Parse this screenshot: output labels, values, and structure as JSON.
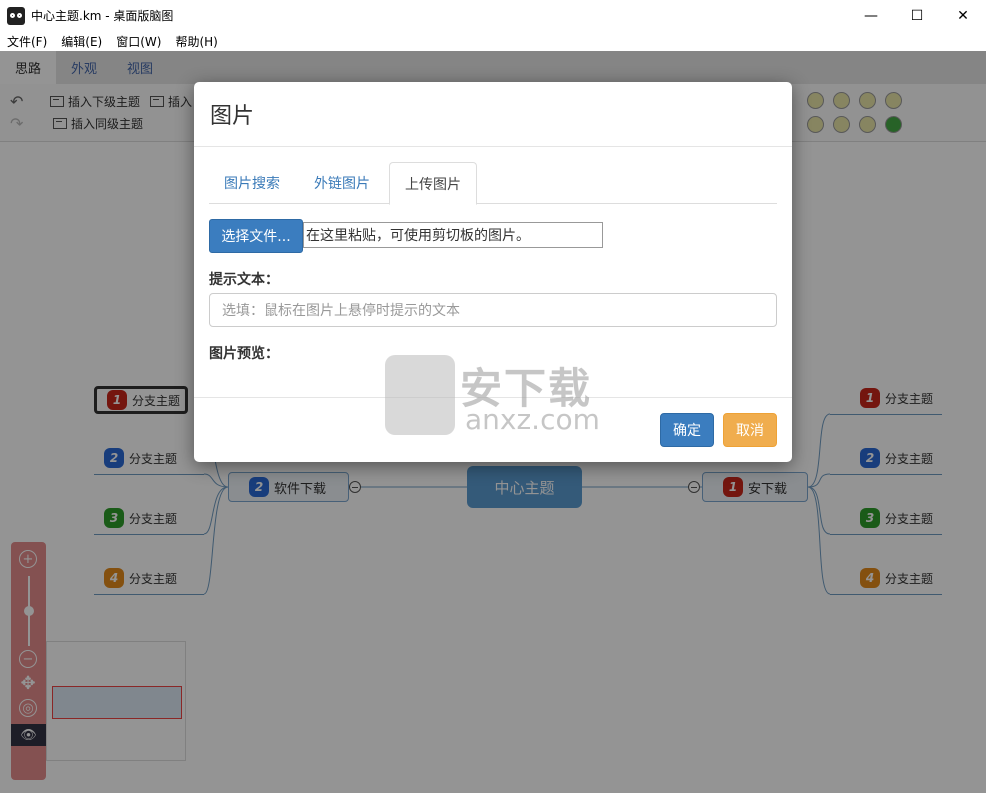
{
  "window": {
    "title": "中心主题.km - 桌面版脑图",
    "minimize": "—",
    "maximize": "☐",
    "close": "✕"
  },
  "menu": [
    "文件(F)",
    "编辑(E)",
    "窗口(W)",
    "帮助(H)"
  ],
  "tabs": [
    "思路",
    "外观",
    "视图"
  ],
  "toolbar": {
    "undo": "↶",
    "redo": "↷",
    "insert_child": "插入下级主题",
    "insert_parent": "插入",
    "insert_sibling": "插入同级主题"
  },
  "mindmap": {
    "center": "中心主题",
    "left_main": {
      "priority": "2",
      "label": "软件下载"
    },
    "right_main": {
      "priority": "1",
      "label": "安下载"
    },
    "branch_label": "分支主题",
    "left_branches": [
      "1",
      "2",
      "3",
      "4"
    ],
    "right_branches": [
      "1",
      "2",
      "3",
      "4"
    ]
  },
  "zoom": {
    "zoom_in": "+",
    "zoom_out": "−",
    "move": "✥",
    "locate": "◎",
    "eye": "👁"
  },
  "dialog": {
    "title": "图片",
    "tabs": [
      "图片搜索",
      "外链图片",
      "上传图片"
    ],
    "choose_file": "选择文件...",
    "paste_hint": "在这里粘贴，可使用剪切板的图片。",
    "hint_label": "提示文本：",
    "hint_placeholder": "选填：鼠标在图片上悬停时提示的文本",
    "preview_label": "图片预览：",
    "ok": "确定",
    "cancel": "取消"
  },
  "watermark": {
    "main": "安下载",
    "sub": "anxz.com"
  },
  "colors": {
    "accent": "#3b7dbf",
    "cancel": "#f0ad4e",
    "center_node": "#5b9bd1",
    "priority_1": "#c9261b",
    "priority_2": "#2a6ad6",
    "priority_3": "#2e9d2a",
    "priority_4": "#e38b1a"
  }
}
